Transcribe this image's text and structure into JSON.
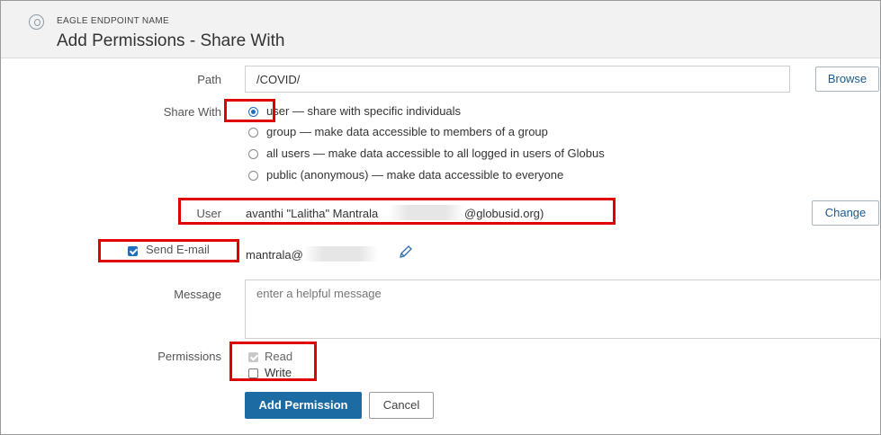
{
  "header": {
    "endpoint_name": "EAGLE ENDPOINT NAME",
    "title": "Add Permissions - Share With"
  },
  "form": {
    "path": {
      "label": "Path",
      "value": "/COVID/",
      "browse_label": "Browse"
    },
    "share_with": {
      "label": "Share With",
      "selected": "user",
      "options": [
        {
          "label": "user — share with specific individuals"
        },
        {
          "label": "group — make data accessible to members of a group"
        },
        {
          "label": "all users — make data accessible to all logged in users of Globus"
        },
        {
          "label": "public (anonymous) — make data accessible to everyone"
        }
      ]
    },
    "user": {
      "label": "User",
      "name_part": "avanthi \"Lalitha\" Mantrala",
      "domain_part": "@globusid.org)",
      "change_label": "Change"
    },
    "send_email": {
      "label": "Send E-mail",
      "checked": true,
      "address": "mantrala@",
      "edit_icon": "pencil-icon"
    },
    "message": {
      "label": "Message",
      "placeholder": "enter a helpful message"
    },
    "permissions": {
      "label": "Permissions",
      "read": {
        "label": "Read",
        "checked": true,
        "disabled": true
      },
      "write": {
        "label": "Write",
        "checked": false
      }
    },
    "add_permission_label": "Add Permission",
    "cancel_label": "Cancel"
  },
  "colors": {
    "primary": "#1d6ba3",
    "highlight": "#e00000"
  }
}
